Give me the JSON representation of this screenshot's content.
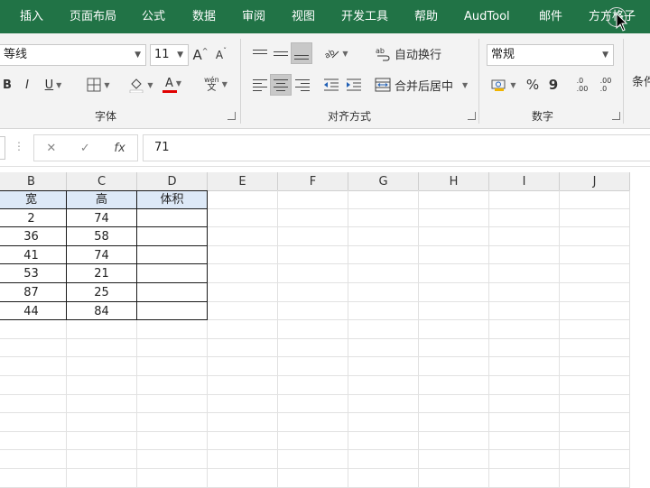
{
  "menu": [
    "插入",
    "页面布局",
    "公式",
    "数据",
    "审阅",
    "视图",
    "开发工具",
    "帮助",
    "AudTool",
    "邮件",
    "方方格子"
  ],
  "ribbon": {
    "font_name": "等线",
    "font_size": "11",
    "increase_font": "A",
    "decrease_font": "A",
    "bold": "B",
    "italic": "I",
    "underline": "U",
    "font_color": "A",
    "phonetic_top": "wén",
    "phonetic_bottom": "文",
    "font_group": "字体",
    "wrap_text": "自动换行",
    "merge_center": "合并后居中",
    "alignment_group": "对齐方式",
    "number_format": "常规",
    "percent": "%",
    "comma": "9",
    "inc_decimal": ".00",
    "dec_decimal": ".0",
    "number_group": "数字",
    "conditional": "条件"
  },
  "formula_bar": {
    "dots": "⋮",
    "cancel": "✕",
    "enter": "✓",
    "fx": "fx",
    "value": "71"
  },
  "columns": [
    "B",
    "C",
    "D",
    "E",
    "F",
    "G",
    "H",
    "I",
    "J"
  ],
  "table": {
    "headers": [
      "宽",
      "高",
      "体积"
    ],
    "rows": [
      [
        "2",
        "74",
        ""
      ],
      [
        "36",
        "58",
        ""
      ],
      [
        "41",
        "74",
        ""
      ],
      [
        "53",
        "21",
        ""
      ],
      [
        "87",
        "25",
        ""
      ],
      [
        "44",
        "84",
        ""
      ]
    ]
  },
  "colors": {
    "menu_bg": "#217346",
    "header_fill": "#dde9f7",
    "font_color_bar": "#e00000"
  }
}
